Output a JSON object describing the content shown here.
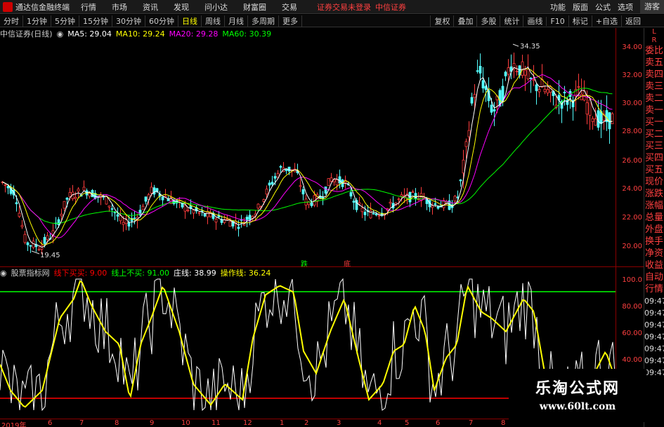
{
  "titlebar": {
    "app_name": "通达信金融终端",
    "menus": [
      "行情",
      "市场",
      "资讯",
      "发现",
      "问小达",
      "财富圈",
      "交易"
    ],
    "notice_1": "证券交易未登录",
    "notice_2": "中信证券",
    "right_items": [
      "功能",
      "版面",
      "公式",
      "选项"
    ],
    "guest": "游客"
  },
  "periodbar": {
    "periods": [
      "分时",
      "1分钟",
      "5分钟",
      "15分钟",
      "30分钟",
      "60分钟",
      "日线",
      "周线",
      "月线",
      "多周期",
      "更多"
    ],
    "active_index": 6,
    "tools": [
      "复权",
      "叠加",
      "多股",
      "统计",
      "画线",
      "F10",
      "标记",
      "+自选",
      "返回"
    ]
  },
  "mainchart": {
    "stock_name": "中信证券(日线)",
    "ma5": "MA5: 29.04",
    "ma10": "MA10: 29.24",
    "ma20": "MA20: 29.28",
    "ma60": "MA60: 30.39",
    "high_label": "34.35",
    "low_label": "19.45",
    "marker_die": "跌",
    "marker_ding": "底",
    "axis_labels": [
      "34.00",
      "32.00",
      "30.00",
      "28.00",
      "26.00",
      "24.00",
      "22.00",
      "20.00"
    ]
  },
  "subchart": {
    "indicator_name": "股票指标网",
    "line_down": "线下买买: 9.00",
    "line_up": "线上不买: 91.00",
    "zhuangxian": "庄线: 38.99",
    "caozuoxian": "操作线: 36.24",
    "axis_labels": [
      "100.0",
      "80.00",
      "60.00",
      "40.00"
    ]
  },
  "dateaxis": {
    "labels": [
      "2019年",
      "6",
      "7",
      "8",
      "9",
      "10",
      "11",
      "12",
      "1",
      "2",
      "3",
      "4",
      "5",
      "6",
      "7",
      "8"
    ]
  },
  "sidepanel": {
    "items": [
      "委比",
      "卖五",
      "卖四",
      "卖三",
      "卖二",
      "卖一",
      "买一",
      "买二",
      "买三",
      "买四",
      "买五",
      "现价",
      "涨跌",
      "涨幅",
      "总量",
      "外盘",
      "换手",
      "净资",
      "收益",
      "自动",
      "行情"
    ],
    "times": [
      "09:47",
      "09:47",
      "09:47",
      "09:47",
      "09:47",
      "09:47",
      "09:47"
    ],
    "top_letters": [
      "L",
      "R"
    ]
  },
  "watermark": {
    "line1": "乐淘公式网",
    "line2": "www.60lt.com"
  },
  "colors": {
    "ma5": "#ffffff",
    "ma10": "#ffff00",
    "ma20": "#ff00ff",
    "ma60": "#00ff00",
    "zhuang": "#ffffff",
    "caozuo": "#ffff00",
    "line91": "#00ff00",
    "line9": "#ff0000"
  }
}
